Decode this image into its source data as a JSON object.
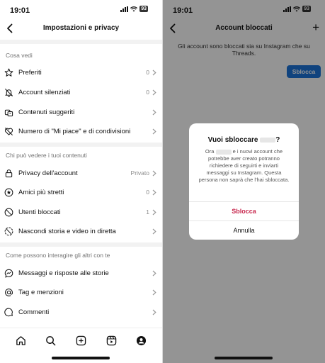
{
  "left": {
    "status": {
      "time": "19:01",
      "battery": "93"
    },
    "title": "Impostazioni e privacy",
    "sections": [
      {
        "header": "Cosa vedi",
        "items": [
          {
            "icon": "star-icon",
            "label": "Preferiti",
            "value": "0"
          },
          {
            "icon": "bell-off-icon",
            "label": "Account silenziati",
            "value": "0"
          },
          {
            "icon": "suggested-content-icon",
            "label": "Contenuti suggeriti",
            "value": ""
          },
          {
            "icon": "heart-off-icon",
            "label": "Numero di \"Mi piace\" e di condivisioni",
            "value": ""
          }
        ]
      },
      {
        "header": "Chi può vedere i tuoi contenuti",
        "items": [
          {
            "icon": "lock-icon",
            "label": "Privacy dell'account",
            "value": "Privato"
          },
          {
            "icon": "close-friends-star-icon",
            "label": "Amici più stretti",
            "value": "0"
          },
          {
            "icon": "blocked-icon",
            "label": "Utenti bloccati",
            "value": "1"
          },
          {
            "icon": "hide-story-icon",
            "label": "Nascondi storia e video in diretta",
            "value": ""
          }
        ]
      },
      {
        "header": "Come possono interagire gli altri con te",
        "items": [
          {
            "icon": "messenger-icon",
            "label": "Messaggi e risposte alle storie",
            "value": ""
          },
          {
            "icon": "at-sign-icon",
            "label": "Tag e menzioni",
            "value": ""
          },
          {
            "icon": "comment-icon",
            "label": "Commenti",
            "value": ""
          }
        ]
      }
    ],
    "tabs": [
      "home-tab-icon",
      "search-tab-icon",
      "create-tab-icon",
      "reels-tab-icon",
      "profile-tab-icon"
    ]
  },
  "right": {
    "status": {
      "time": "19:01",
      "battery": "93"
    },
    "title": "Account bloccati",
    "info": "Gli account sono bloccati sia su Instagram che su Threads.",
    "unblock_label": "Sblocca",
    "dialog": {
      "title_prefix": "Vuoi sbloccare",
      "title_suffix": "?",
      "body_prefix": "Ora",
      "body_rest": "e i nuovi account che potrebbe aver creato potranno richiedere di seguirti e inviarti messaggi su Instagram. Questa persona non saprà che l'hai sbloccata.",
      "primary": "Sblocca",
      "secondary": "Annulla"
    }
  },
  "colors": {
    "accent_blue": "#1d74d9",
    "destructive": "#c8294f",
    "section_gray": "#f2f2f2"
  }
}
